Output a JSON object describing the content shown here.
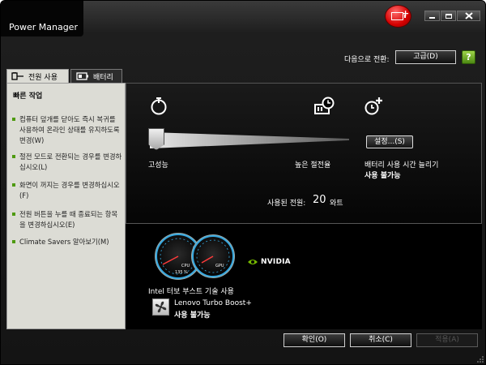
{
  "window": {
    "title": "Power Manager"
  },
  "header": {
    "switch_label": "다음으로 전환:",
    "advanced_button": "고급(D)",
    "help_icon": "help-icon"
  },
  "tabs": [
    {
      "label": "전원 사용",
      "icon": "power-plug-icon",
      "selected": true
    },
    {
      "label": "배터리",
      "icon": "battery-icon",
      "selected": false
    }
  ],
  "quick_actions": {
    "title": "빠른 작업",
    "items": [
      {
        "label": "컴퓨터 덮개를 닫아도 즉시 복귀를 사용하여 온라인 상태를 유지하도록 변경(W)"
      },
      {
        "label": "절전 모드로 전환되는 경우를 변경하십시오(L)"
      },
      {
        "label": "화면이 꺼지는 경우를 변경하십시오(F)"
      },
      {
        "label": "전원 버튼을 누를 때 종료되는 항목을 변경하십시오(E)"
      },
      {
        "label": "Climate Savers 알아보기(M)"
      }
    ]
  },
  "power_plan": {
    "left_label": "고성능",
    "right_label": "높은 절전율",
    "extend_label": "배터리 사용 시간 늘리기",
    "status": "사용 불가능",
    "settings_button": "설정...(S)",
    "used_power_label": "사용된 전원:",
    "used_power_value": "20",
    "used_power_unit": "와트",
    "icons": [
      "stopwatch-icon",
      "battery-timer-icon",
      "add-time-icon"
    ]
  },
  "performance": {
    "cpu_label": "CPU",
    "cpu_value": "135 %",
    "gpu_label": "GPU",
    "brand": "NVIDIA",
    "turbo_label": "Intel 터보 부스트 기술 사용",
    "lenovo_label": "Lenovo Turbo Boost+",
    "lenovo_status": "사용 불가능"
  },
  "footer": {
    "ok": "확인(O)",
    "cancel": "취소(C)",
    "apply": "적용(A)"
  },
  "colors": {
    "accent_green": "#4e9a10",
    "badge_red": "#d40000",
    "gauge_blue": "#35a8e0"
  }
}
